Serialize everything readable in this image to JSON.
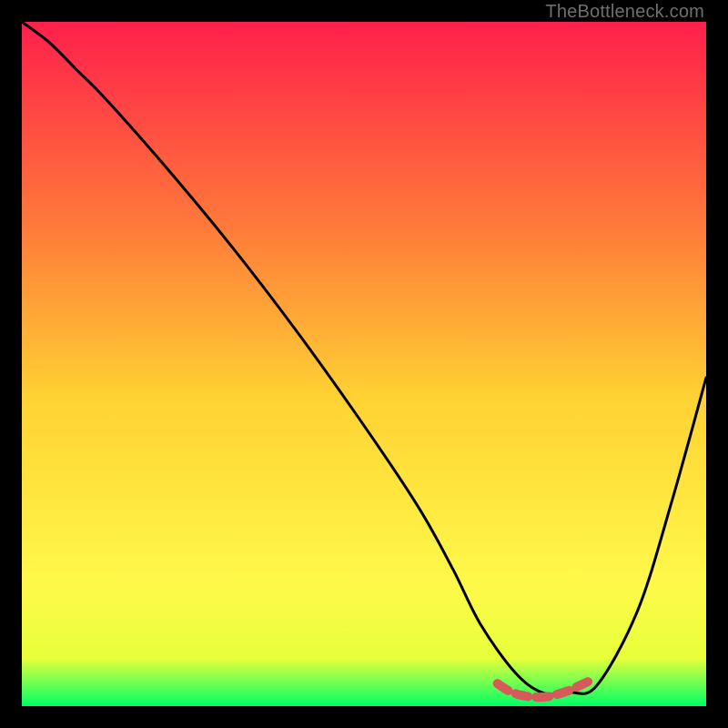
{
  "watermark": "TheBottleneck.com",
  "colors": {
    "bg": "#000000",
    "grad_top": "#ff1f4b",
    "grad_upper_mid": "#ff7a3a",
    "grad_mid": "#ffd233",
    "grad_low": "#fff94a",
    "grad_base1": "#e7ff3a",
    "grad_base2": "#00ff66",
    "curve": "#000000",
    "marker": "#d65a5a"
  },
  "chart_data": {
    "type": "line",
    "title": "",
    "xlabel": "",
    "ylabel": "",
    "xlim": [
      0,
      100
    ],
    "ylim": [
      0,
      100
    ],
    "series": [
      {
        "name": "bottleneck-curve",
        "x": [
          0,
          4,
          8,
          12,
          20,
          30,
          40,
          50,
          58,
          63,
          67,
          72,
          76,
          80,
          84,
          90,
          95,
          100
        ],
        "y": [
          100,
          97,
          93,
          89,
          80,
          68,
          55,
          41,
          29,
          20,
          12,
          5,
          2,
          2,
          3,
          14,
          30,
          48
        ]
      }
    ],
    "markers": {
      "name": "optimum-band",
      "x": [
        69.5,
        71.0,
        72.5,
        74.0,
        75.5,
        77.0,
        78.5,
        80.0,
        81.5,
        83.0
      ],
      "y": [
        3.3,
        2.3,
        1.7,
        1.4,
        1.3,
        1.4,
        1.8,
        2.3,
        3.0,
        3.7
      ]
    }
  }
}
